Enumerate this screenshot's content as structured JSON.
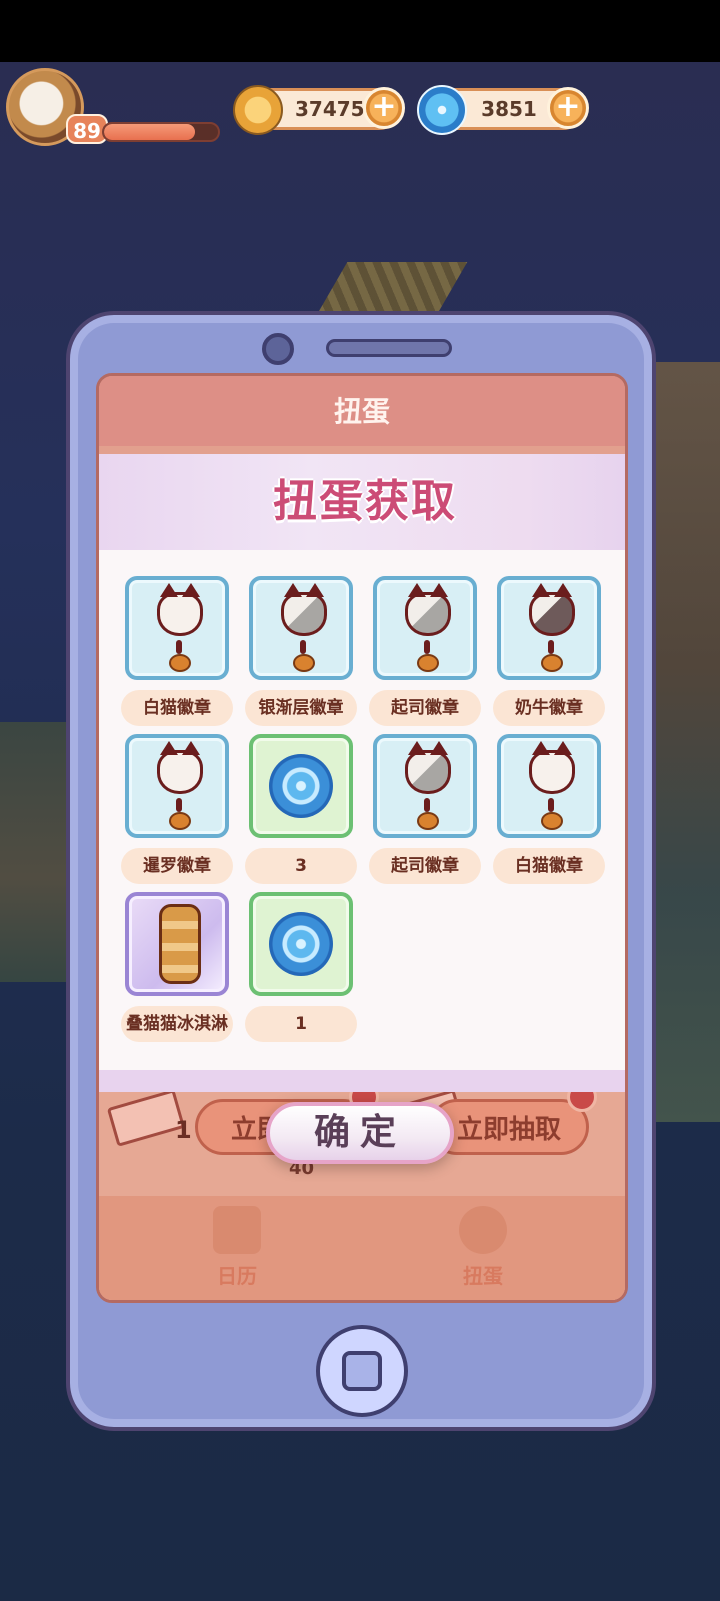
{
  "hud": {
    "player_level": "89",
    "xp_fraction": 0.8,
    "coins": "37475",
    "gems": "3851",
    "add_symbol": "+"
  },
  "phone_screen": {
    "header_title": "扭蛋",
    "draw_button_left": "立即抽取",
    "draw_button_right": "立即抽取",
    "ticket_count": "1",
    "remaining_text": "40",
    "nav": [
      {
        "label": "日历",
        "icon": "calendar-icon"
      },
      {
        "label": "扭蛋",
        "icon": "gacha-icon"
      }
    ]
  },
  "popup": {
    "title": "扭蛋获取",
    "items": [
      {
        "label": "白猫徽章",
        "type": "badge",
        "variant": "white"
      },
      {
        "label": "银渐层徽章",
        "type": "badge",
        "variant": "gray"
      },
      {
        "label": "起司徽章",
        "type": "badge",
        "variant": "gray"
      },
      {
        "label": "奶牛徽章",
        "type": "badge",
        "variant": "dark"
      },
      {
        "label": "暹罗徽章",
        "type": "badge",
        "variant": "white"
      },
      {
        "label": "3",
        "type": "gem"
      },
      {
        "label": "起司徽章",
        "type": "badge",
        "variant": "gray"
      },
      {
        "label": "白猫徽章",
        "type": "badge",
        "variant": "white"
      },
      {
        "label": "叠猫猫冰淇淋",
        "type": "special"
      },
      {
        "label": "1",
        "type": "gem"
      }
    ],
    "confirm_label": "确定"
  }
}
